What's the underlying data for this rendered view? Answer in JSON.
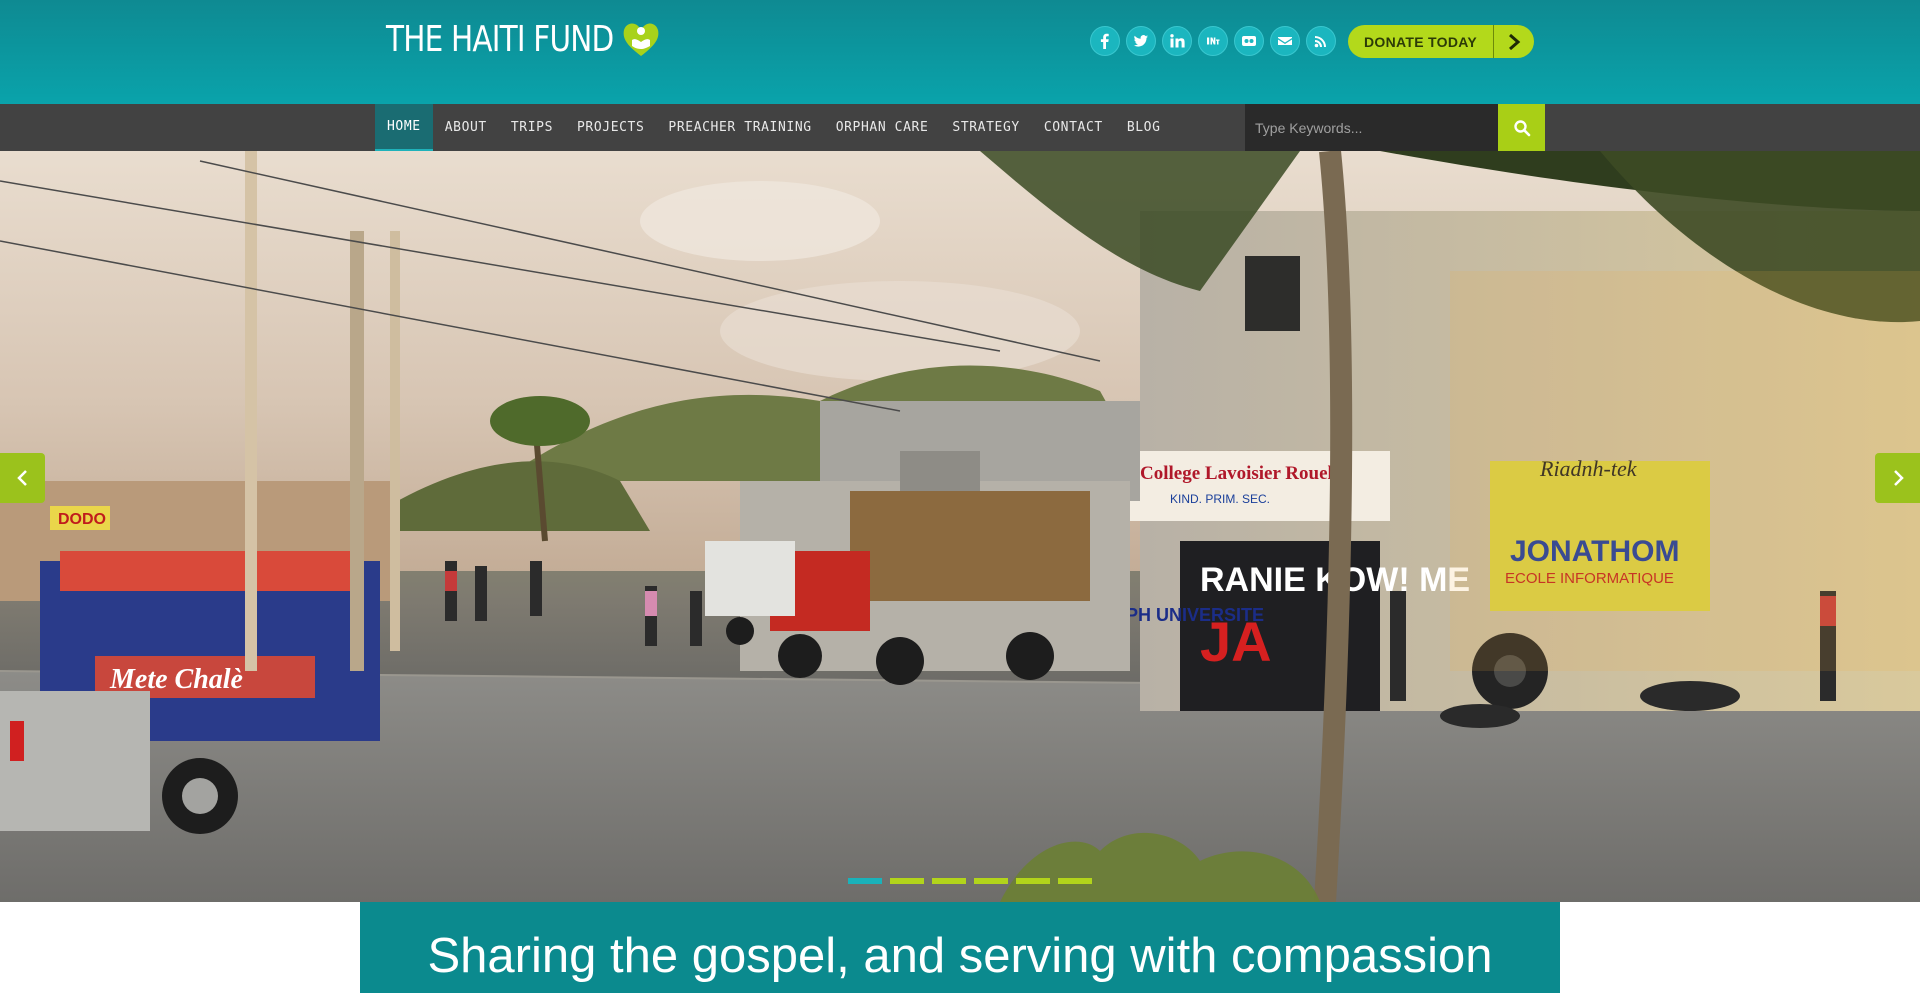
{
  "site": {
    "title": "THE HAITI FUND"
  },
  "header": {
    "social": [
      {
        "icon": "facebook-icon",
        "glyph": "f"
      },
      {
        "icon": "twitter-icon",
        "glyph": "t"
      },
      {
        "icon": "linkedin-icon",
        "glyph": "in"
      },
      {
        "icon": "youtube-icon",
        "glyph": "yt"
      },
      {
        "icon": "flickr-icon",
        "glyph": "fl"
      },
      {
        "icon": "envelope-icon",
        "glyph": "@"
      },
      {
        "icon": "rss-icon",
        "glyph": "rss"
      }
    ],
    "donate_label": "DONATE TODAY"
  },
  "nav": {
    "items": [
      {
        "label": "HOME",
        "active": true
      },
      {
        "label": "ABOUT",
        "active": false
      },
      {
        "label": "TRIPS",
        "active": false
      },
      {
        "label": "PROJECTS",
        "active": false
      },
      {
        "label": "PREACHER TRAINING",
        "active": false
      },
      {
        "label": "ORPHAN CARE",
        "active": false
      },
      {
        "label": "STRATEGY",
        "active": false
      },
      {
        "label": "CONTACT",
        "active": false
      },
      {
        "label": "BLOG",
        "active": false
      }
    ],
    "search": {
      "placeholder": "Type Keywords..."
    }
  },
  "hero": {
    "slide_count": 6,
    "active_slide": 1,
    "signage": {
      "bus_text_1": "Mete Chalè",
      "school_sign": "College Lavoisier Rouelus",
      "school_sign_sub": "KIND. PRIM. SEC.",
      "wall_text_1": "RANIE KOW! ME",
      "wall_text_2": "JA",
      "wall_text_3": "CUPH UNIVERSITE",
      "wall_text_4": "JONATHOM",
      "wall_text_5": "ECOLE INFORMATIQUE",
      "wall_text_6": "Riadnh-tek",
      "wall_text_7": "DODO"
    }
  },
  "tagline": {
    "text": "Sharing the gospel, and serving with compassion"
  },
  "colors": {
    "header_teal": "#0e8a92",
    "accent_green": "#b3d91b",
    "nav_dark": "#282828",
    "tagline_teal": "#0b8a8e"
  }
}
